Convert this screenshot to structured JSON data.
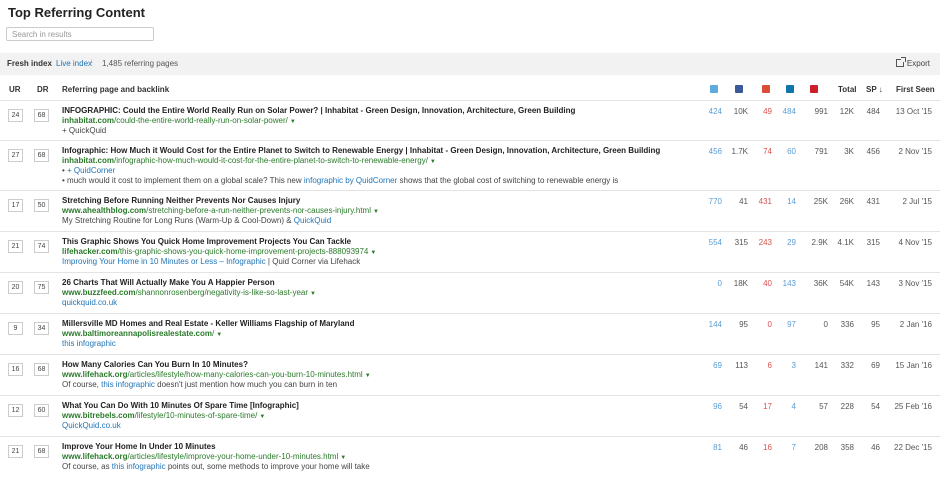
{
  "page_title": "Top Referring Content",
  "search": {
    "placeholder": "Search in results"
  },
  "toolbar": {
    "fresh_label": "Fresh index",
    "live_label": "Live index",
    "live_dropdown": "↓",
    "count_label": "1,485 referring pages",
    "export_label": "Export"
  },
  "columns": {
    "ur": "UR",
    "dr": "DR",
    "ref": "Referring page and backlink",
    "total": "Total",
    "sp": "SP ↓",
    "first_seen": "First Seen"
  },
  "colors": {
    "link": "#1f74b8",
    "url": "#2a7a2a",
    "gplus": "#d9534f"
  },
  "rows": [
    {
      "ur": "24",
      "dr": "68",
      "title": "INFOGRAPHIC: Could the Entire World Really Run on Solar Power? | Inhabitat - Green Design, Innovation, Architecture, Green Building",
      "domain": "inhabitat.com",
      "path": "/could-the-entire-world-really-run-on-solar-power/",
      "l1a": "+ QuickQuid",
      "l1b": "",
      "l1c": "",
      "l2a": "",
      "l2b": "",
      "l2c": "",
      "tw": "424",
      "fb": "10K",
      "gp": "49",
      "li": "484",
      "pi": "991",
      "total": "12K",
      "sp": "484",
      "first_seen": "13 Oct '15"
    },
    {
      "ur": "27",
      "dr": "68",
      "title": "Infographic: How Much it Would Cost for the Entire Planet to Switch to Renewable Energy | Inhabitat - Green Design, Innovation, Architecture, Green Building",
      "domain": "inhabitat.com",
      "path": "/infographic-how-much-would-it-cost-for-the-entire-planet-to-switch-to-renewable-energy/",
      "l1a": "• ",
      "l1b": "+ QuidCorner",
      "l1c": "",
      "l2a": "• much would it cost to implement them on a global scale? This new ",
      "l2b": "infographic by QuidCorner",
      "l2c": " shows that the global cost of switching to renewable energy is",
      "tw": "456",
      "fb": "1.7K",
      "gp": "74",
      "li": "60",
      "pi": "791",
      "total": "3K",
      "sp": "456",
      "first_seen": "2 Nov '15"
    },
    {
      "ur": "17",
      "dr": "50",
      "title": "Stretching Before Running Neither Prevents Nor Causes Injury",
      "domain": "www.ahealthblog.com",
      "path": "/stretching-before-a-run-neither-prevents-nor-causes-injury.html",
      "l1a": "My Stretching Routine for Long Runs (Warm-Up & Cool-Down) & ",
      "l1b": "QuickQuid",
      "l1c": "",
      "l2a": "",
      "l2b": "",
      "l2c": "",
      "tw": "770",
      "fb": "41",
      "gp": "431",
      "li": "14",
      "pi": "25K",
      "total": "26K",
      "sp": "431",
      "first_seen": "2 Jul '15"
    },
    {
      "ur": "21",
      "dr": "74",
      "title": "This Graphic Shows You Quick Home Improvement Projects You Can Tackle",
      "domain": "lifehacker.com",
      "path": "/this-graphic-shows-you-quick-home-improvement-projects-888093974",
      "l1a": "",
      "l1b": "Improving Your Home in 10 Minutes or Less – Infographic",
      "l1c": " | Quid Corner via Lifehack",
      "l2a": "",
      "l2b": "",
      "l2c": "",
      "tw": "554",
      "fb": "315",
      "gp": "243",
      "li": "29",
      "pi": "2.9K",
      "total": "4.1K",
      "sp": "315",
      "first_seen": "4 Nov '15"
    },
    {
      "ur": "20",
      "dr": "75",
      "title": "26 Charts That Will Actually Make You A Happier Person",
      "domain": "www.buzzfeed.com",
      "path": "/shannonrosenberg/negativity-is-like-so-last-year",
      "l1a": "",
      "l1b": "quickquid.co.uk",
      "l1c": "",
      "l2a": "",
      "l2b": "",
      "l2c": "",
      "tw": "0",
      "fb": "18K",
      "gp": "40",
      "li": "143",
      "pi": "36K",
      "total": "54K",
      "sp": "143",
      "first_seen": "3 Nov '15"
    },
    {
      "ur": "9",
      "dr": "34",
      "title": "Millersville MD Homes and Real Estate - Keller Williams Flagship of Maryland",
      "domain": "www.baltimoreannapolisrealestate.com",
      "path": "/",
      "l1a": "",
      "l1b": "this infographic",
      "l1c": "",
      "l2a": "",
      "l2b": "",
      "l2c": "",
      "tw": "144",
      "fb": "95",
      "gp": "0",
      "li": "97",
      "pi": "0",
      "total": "336",
      "sp": "95",
      "first_seen": "2 Jan '16"
    },
    {
      "ur": "16",
      "dr": "68",
      "title": "How Many Calories Can You Burn In 10 Minutes?",
      "domain": "www.lifehack.org",
      "path": "/articles/lifestyle/how-many-calories-can-you-burn-10-minutes.html",
      "l1a": "Of course, ",
      "l1b": "this infographic",
      "l1c": " doesn't just mention how much you can burn in ten",
      "l2a": "",
      "l2b": "",
      "l2c": "",
      "tw": "69",
      "fb": "113",
      "gp": "6",
      "li": "3",
      "pi": "141",
      "total": "332",
      "sp": "69",
      "first_seen": "15 Jan '16"
    },
    {
      "ur": "12",
      "dr": "60",
      "title": "What You Can Do With 10 Minutes Of Spare Time [Infographic]",
      "domain": "www.bitrebels.com",
      "path": "/lifestyle/10-minutes-of-spare-time/",
      "l1a": "",
      "l1b": "QuickQuid.co.uk",
      "l1c": "",
      "l2a": "",
      "l2b": "",
      "l2c": "",
      "tw": "96",
      "fb": "54",
      "gp": "17",
      "li": "4",
      "pi": "57",
      "total": "228",
      "sp": "54",
      "first_seen": "25 Feb '16"
    },
    {
      "ur": "21",
      "dr": "68",
      "title": "Improve Your Home In Under 10 Minutes",
      "domain": "www.lifehack.org",
      "path": "/articles/lifestyle/improve-your-home-under-10-minutes.html",
      "l1a": "Of course, as ",
      "l1b": "this infographic",
      "l1c": " points out, some methods to improve your home will take",
      "l2a": "",
      "l2b": "",
      "l2c": "",
      "tw": "81",
      "fb": "46",
      "gp": "16",
      "li": "7",
      "pi": "208",
      "total": "358",
      "sp": "46",
      "first_seen": "22 Dec '15"
    }
  ]
}
